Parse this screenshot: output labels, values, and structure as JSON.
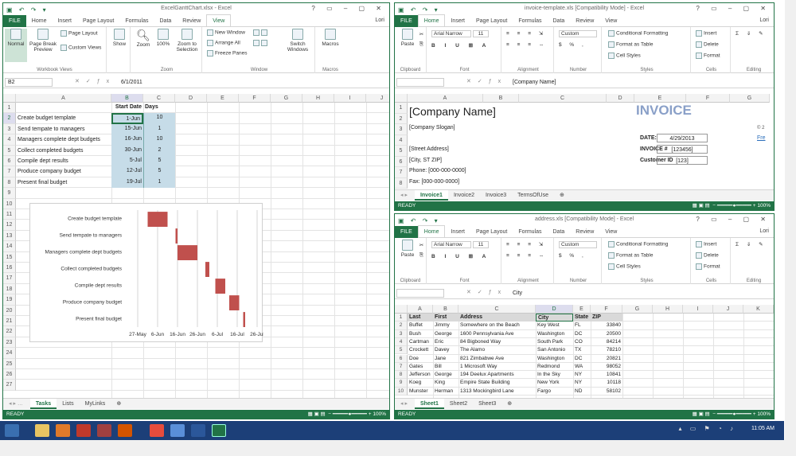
{
  "left": {
    "title": "ExcelGanttChart.xlsx - Excel",
    "user": "Lori",
    "tabs": [
      "FILE",
      "Home",
      "Insert",
      "Page Layout",
      "Formulas",
      "Data",
      "Review",
      "View"
    ],
    "active_tab": "View",
    "ribbon": {
      "normal": "Normal",
      "page_break": "Page Break Preview",
      "page_layout": "Page Layout",
      "custom_views": "Custom Views",
      "show": "Show",
      "zoom": "Zoom",
      "zoom100": "100%",
      "zoom_sel": "Zoom to Selection",
      "new_window": "New Window",
      "arrange_all": "Arrange All",
      "freeze": "Freeze Panes",
      "switch": "Switch Windows",
      "macros": "Macros",
      "g_views": "Workbook Views",
      "g_zoom": "Zoom",
      "g_window": "Window",
      "g_macros": "Macros"
    },
    "namebox": "B2",
    "formula": "6/1/2011",
    "cols": [
      "A",
      "B",
      "C",
      "D",
      "E",
      "F",
      "G",
      "H",
      "I",
      "J"
    ],
    "rows": [
      "1",
      "2",
      "3",
      "4",
      "5",
      "6",
      "7",
      "8",
      "9",
      "10",
      "11",
      "12",
      "13",
      "14",
      "15",
      "16",
      "17",
      "18",
      "19",
      "20",
      "21",
      "22",
      "23",
      "24",
      "25",
      "26",
      "27"
    ],
    "headers": {
      "b": "Start Date",
      "c": "Days"
    },
    "tasks": [
      {
        "a": "Create budget template",
        "b": "1-Jun",
        "c": "10"
      },
      {
        "a": "Send tempate to managers",
        "b": "15-Jun",
        "c": "1"
      },
      {
        "a": "Managers complete dept budgets",
        "b": "16-Jun",
        "c": "10"
      },
      {
        "a": "Collect completed budgets",
        "b": "30-Jun",
        "c": "2"
      },
      {
        "a": "Compile dept results",
        "b": "5-Jul",
        "c": "5"
      },
      {
        "a": "Produce company budget",
        "b": "12-Jul",
        "c": "5"
      },
      {
        "a": "Present final budget",
        "b": "19-Jul",
        "c": "1"
      }
    ],
    "sheets": [
      "Tasks",
      "Lists",
      "MyLinks"
    ],
    "status": "READY",
    "zoom_pct": "100%"
  },
  "chart_data": {
    "type": "bar",
    "orientation": "horizontal-gantt",
    "categories": [
      "Create budget template",
      "Send tempate to managers",
      "Managers complete dept budgets",
      "Collect completed budgets",
      "Compile dept results",
      "Produce company budget",
      "Present final budget"
    ],
    "start_days": [
      5,
      19,
      20,
      34,
      39,
      46,
      53
    ],
    "durations": [
      10,
      1,
      10,
      2,
      5,
      5,
      1
    ],
    "x_ticks": [
      "27-May",
      "6-Jun",
      "16-Jun",
      "26-Jun",
      "6-Jul",
      "16-Jul",
      "26-Jul"
    ],
    "xlim_days": [
      0,
      60
    ],
    "bar_color": "#c0504d",
    "grid": "vertical"
  },
  "top_right": {
    "title": "invoice-template.xls [Compatibility Mode] - Excel",
    "user": "Lori",
    "tabs": [
      "FILE",
      "Home",
      "Insert",
      "Page Layout",
      "Formulas",
      "Data",
      "Review",
      "View"
    ],
    "active_tab": "Home",
    "font": "Arial Narrow",
    "size": "11",
    "numfmt": "Custom",
    "cond": "Conditional Formatting",
    "fmt_table": "Format as Table",
    "cell_styles": "Cell Styles",
    "insert": "Insert",
    "delete": "Delete",
    "format": "Format",
    "paste": "Paste",
    "g": [
      "Clipboard",
      "Font",
      "Alignment",
      "Number",
      "Styles",
      "Cells",
      "Editing"
    ],
    "namebox": "",
    "formula": "[Company Name]",
    "cols": [
      "A",
      "B",
      "C",
      "D",
      "E",
      "F",
      "G"
    ],
    "rows": [
      "1",
      "2",
      "3",
      "4",
      "5",
      "6",
      "7",
      "8"
    ],
    "company": "[Company Name]",
    "slogan": "[Company Slogan]",
    "invoice": "INVOICE",
    "addr": [
      "[Street Address]",
      "[City, ST  ZIP]",
      "Phone: [000-000-0000]",
      "Fax: [000-000-0000]"
    ],
    "date_label": "DATE:",
    "date_val": "4/29/2013",
    "inv_label": "INVOICE #",
    "inv_val": "[123456]",
    "cust_label": "Customer ID",
    "cust_val": "[123]",
    "edge1": "© 2",
    "edge2": "Fre",
    "sheets": [
      "Invoice1",
      "Invoice2",
      "Invoice3",
      "TermsOfUse"
    ],
    "status": "READY",
    "zoom_pct": "100%"
  },
  "bottom_right": {
    "title": "address.xls [Compatibility Mode] - Excel",
    "user": "Lori",
    "tabs": [
      "FILE",
      "Home",
      "Insert",
      "Page Layout",
      "Formulas",
      "Data",
      "Review",
      "View"
    ],
    "active_tab": "Home",
    "font": "Arial Narrow",
    "size": "11",
    "numfmt": "Custom",
    "cond": "Conditional Formatting",
    "fmt_table": "Format as Table",
    "cell_styles": "Cell Styles",
    "insert": "Insert",
    "delete": "Delete",
    "format": "Format",
    "paste": "Paste",
    "g": [
      "Clipboard",
      "Font",
      "Alignment",
      "Number",
      "Styles",
      "Cells",
      "Editing"
    ],
    "formula": "City",
    "cols": [
      "A",
      "B",
      "C",
      "D",
      "E",
      "F",
      "G",
      "H",
      "I",
      "J",
      "K"
    ],
    "header": [
      "Last",
      "First",
      "Address",
      "City",
      "State",
      "ZIP"
    ],
    "rows": [
      [
        "Buffet",
        "Jimmy",
        "Somewhere on the Beach",
        "Key West",
        "FL",
        "33840"
      ],
      [
        "Bush",
        "George",
        "1600 Pennsylvania Ave",
        "Washington",
        "DC",
        "20500"
      ],
      [
        "Cartman",
        "Eric",
        "84 Bigboned Way",
        "South Park",
        "CO",
        "84214"
      ],
      [
        "Crockett",
        "Davey",
        "The Alamo",
        "San Antonio",
        "TX",
        "78210"
      ],
      [
        "Doe",
        "Jane",
        "821 Zimbabwe Ave",
        "Washington",
        "DC",
        "20821"
      ],
      [
        "Gates",
        "Bill",
        "1 Microsoft Way",
        "Redmond",
        "WA",
        "98052"
      ],
      [
        "Jefferson",
        "George",
        "194 Deelux Apartments",
        "In the Sky",
        "NY",
        "10841"
      ],
      [
        "Koeg",
        "King",
        "Empire State Building",
        "New York",
        "NY",
        "10118"
      ],
      [
        "Munster",
        "Herman",
        "1313 Mockingbird Lane",
        "Fargo",
        "ND",
        "58102"
      ]
    ],
    "rownums": [
      "1",
      "2",
      "3",
      "4",
      "5",
      "6",
      "7",
      "8",
      "9",
      "10"
    ],
    "sheets": [
      "Sheet1",
      "Sheet2",
      "Sheet3"
    ],
    "status": "READY",
    "zoom_pct": "100%"
  },
  "taskbar": {
    "clock": "11:05 AM"
  },
  "colors": {
    "excel_green": "#217346",
    "selection": "#c6dce8",
    "taskbar": "#1c3f78"
  }
}
